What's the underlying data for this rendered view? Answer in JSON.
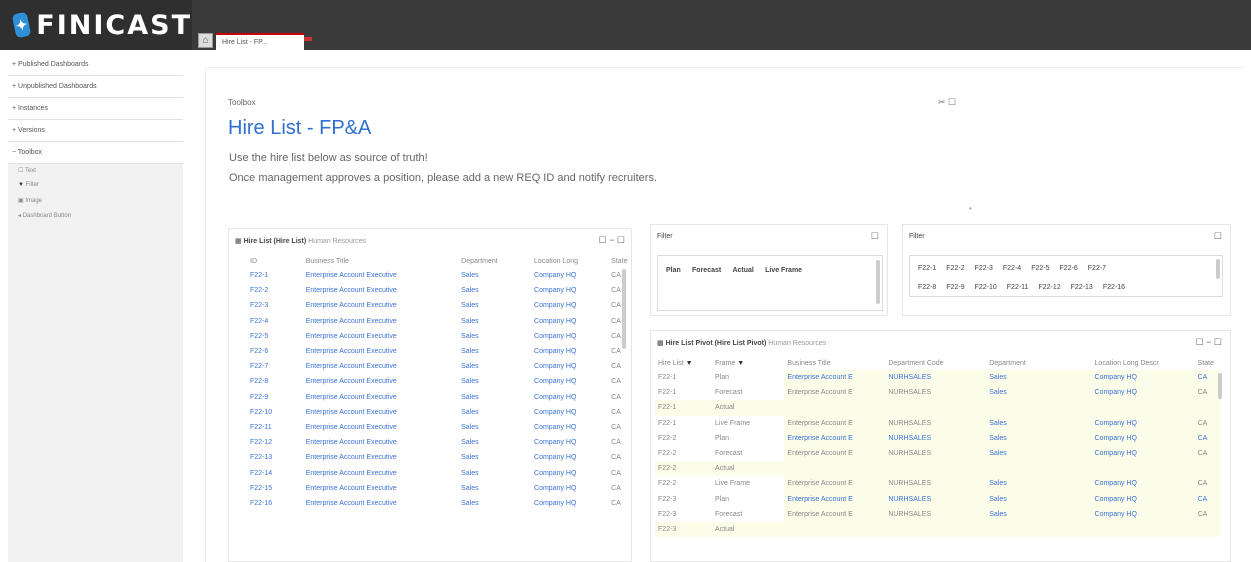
{
  "app": {
    "logo_text": "FINICAST",
    "tab_label": "Hire List - FP..."
  },
  "sidebar": {
    "items": [
      {
        "label": "+ Published Dashboards"
      },
      {
        "label": "+ Unpublished Dashboards"
      },
      {
        "label": "+ Instances"
      },
      {
        "label": "+ Versions"
      },
      {
        "label": "− Toolbox"
      }
    ],
    "toolbox_items": [
      {
        "icon": "text-icon",
        "label": "Text"
      },
      {
        "icon": "filter-icon",
        "label": "Filter"
      },
      {
        "icon": "image-icon",
        "label": "Image"
      },
      {
        "icon": "button-icon",
        "label": "Dashboard Button"
      }
    ]
  },
  "page": {
    "breadcrumb": "Toolbox",
    "title": "Hire List - FP&A",
    "line1": "Use the hire list below as source of truth!",
    "line2": "Once management approves a position, please add a new REQ ID and notify recruiters.",
    "icons": "✂ ☐"
  },
  "hire_list": {
    "title": "Hire List (Hire List)",
    "subtitle": "Human Resources",
    "icons": "☐ − ☐",
    "columns": [
      "ID",
      "Business Title",
      "Department",
      "Location Long",
      "State"
    ],
    "rows": [
      [
        "F22-1",
        "Enterprise Account Executive",
        "Sales",
        "Company HQ",
        "CA"
      ],
      [
        "F22-2",
        "Enterprise Account Executive",
        "Sales",
        "Company HQ",
        "CA"
      ],
      [
        "F22-3",
        "Enterprise Account Executive",
        "Sales",
        "Company HQ",
        "CA"
      ],
      [
        "F22-4",
        "Enterprise Account Executive",
        "Sales",
        "Company HQ",
        "CA"
      ],
      [
        "F22-5",
        "Enterprise Account Executive",
        "Sales",
        "Company HQ",
        "CA"
      ],
      [
        "F22-6",
        "Enterprise Account Executive",
        "Sales",
        "Company HQ",
        "CA"
      ],
      [
        "F22-7",
        "Enterprise Account Executive",
        "Sales",
        "Company HQ",
        "CA"
      ],
      [
        "F22-8",
        "Enterprise Account Executive",
        "Sales",
        "Company HQ",
        "CA"
      ],
      [
        "F22-9",
        "Enterprise Account Executive",
        "Sales",
        "Company HQ",
        "CA"
      ],
      [
        "F22-10",
        "Enterprise Account Executive",
        "Sales",
        "Company HQ",
        "CA"
      ],
      [
        "F22-11",
        "Enterprise Account Executive",
        "Sales",
        "Company HQ",
        "CA"
      ],
      [
        "F22-12",
        "Enterprise Account Executive",
        "Sales",
        "Company HQ",
        "CA"
      ],
      [
        "F22-13",
        "Enterprise Account Executive",
        "Sales",
        "Company HQ",
        "CA"
      ],
      [
        "F22-14",
        "Enterprise Account Executive",
        "Sales",
        "Company HQ",
        "CA"
      ],
      [
        "F22-15",
        "Enterprise Account Executive",
        "Sales",
        "Company HQ",
        "CA"
      ],
      [
        "F22-16",
        "Enterprise Account Executive",
        "Sales",
        "Company HQ",
        "CA"
      ]
    ]
  },
  "filter1": {
    "title": "Filter",
    "icon": "☐",
    "options": [
      "Plan",
      "Forecast",
      "Actual",
      "Live Frame"
    ]
  },
  "filter2": {
    "title": "Filter",
    "icon": "☐",
    "row1": [
      "F22-1",
      "F22-2",
      "F22-3",
      "F22-4",
      "F22-5",
      "F22-6",
      "F22-7"
    ],
    "row2": [
      "F22-8",
      "F22-9",
      "F22-10",
      "F22-11",
      "F22-12",
      "F22-13",
      "F22-16"
    ]
  },
  "pivot": {
    "title": "Hire List Pivot (Hire List Pivot)",
    "subtitle": "Human Resources",
    "icons": "☐ − ☐",
    "columns": [
      "Hire List",
      "Frame",
      "Business Title",
      "Department Code",
      "Department",
      "Location Long Descr",
      "State"
    ],
    "rows": [
      [
        "F22-1",
        "Plan",
        "Enterprise Account E",
        "NURHSALES",
        "Sales",
        "Company HQ",
        "CA"
      ],
      [
        "F22-1",
        "Forecast",
        "Enterprise Account E",
        "NURHSALES",
        "Sales",
        "Company HQ",
        "CA"
      ],
      [
        "F22-1",
        "Actual",
        "",
        "",
        "",
        "",
        ""
      ],
      [
        "F22-1",
        "Live Frame",
        "Enterprise Account E",
        "NURHSALES",
        "Sales",
        "Company HQ",
        "CA"
      ],
      [
        "F22-2",
        "Plan",
        "Enterprise Account E",
        "NURHSALES",
        "Sales",
        "Company HQ",
        "CA"
      ],
      [
        "F22-2",
        "Forecast",
        "Enterprise Account E",
        "NURHSALES",
        "Sales",
        "Company HQ",
        "CA"
      ],
      [
        "F22-2",
        "Actual",
        "",
        "",
        "",
        "",
        ""
      ],
      [
        "F22-2",
        "Live Frame",
        "Enterprise Account E",
        "NURHSALES",
        "Sales",
        "Company HQ",
        "CA"
      ],
      [
        "F22-3",
        "Plan",
        "Enterprise Account E",
        "NURHSALES",
        "Sales",
        "Company HQ",
        "CA"
      ],
      [
        "F22-3",
        "Forecast",
        "Enterprise Account E",
        "NURHSALES",
        "Sales",
        "Company HQ",
        "CA"
      ],
      [
        "F22-3",
        "Actual",
        "",
        "",
        "",
        "",
        ""
      ]
    ]
  }
}
